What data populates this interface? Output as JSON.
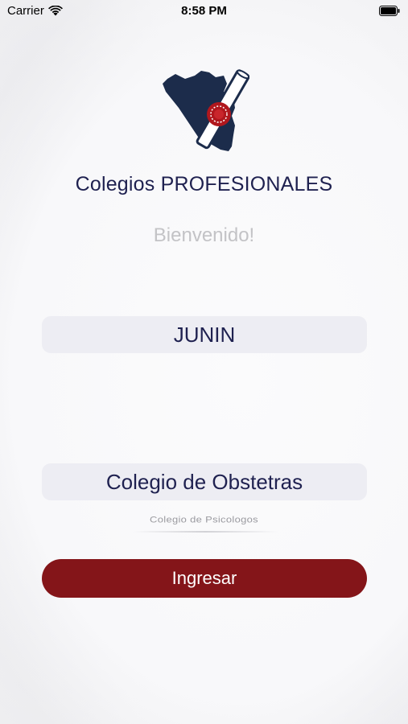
{
  "status_bar": {
    "carrier": "Carrier",
    "time": "8:58 PM"
  },
  "app": {
    "title": "Colegios PROFESIONALES",
    "welcome": "Bienvenido!"
  },
  "form": {
    "region_value": "JUNIN",
    "college_value": "Colegio de Obstetras",
    "college_next_option": "Colegio de Psicologos",
    "submit_label": "Ingresar"
  },
  "icons": {
    "wifi": "wifi-icon",
    "battery": "battery-icon",
    "logo": "peru-map-diploma-logo"
  },
  "colors": {
    "brand_navy": "#1f2150",
    "button_red": "#841519",
    "field_bg": "#ededf3",
    "muted_text": "#c3c3c6"
  }
}
